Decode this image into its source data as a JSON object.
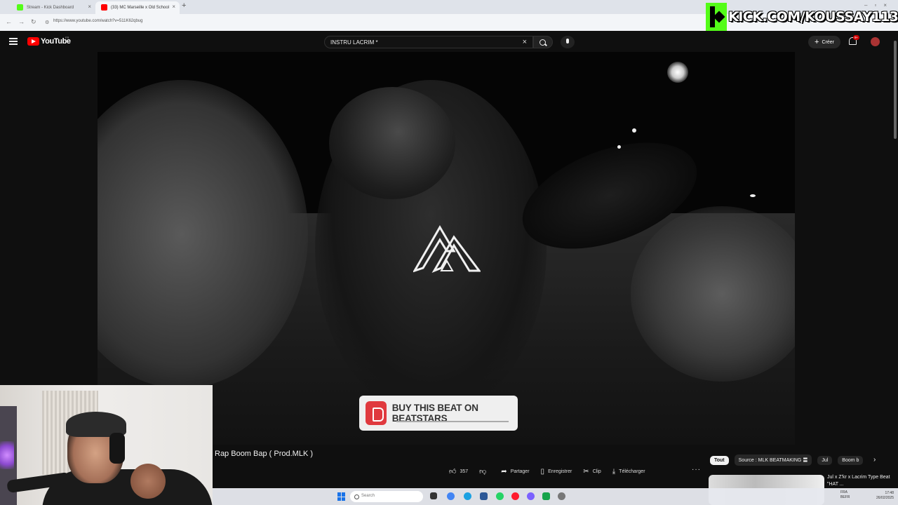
{
  "browser": {
    "tabs": [
      {
        "title": "Stream - Kick Dashboard",
        "favicon_color": "#53fc18"
      },
      {
        "title": "(33) MC Marseille x Old School",
        "favicon_color": "#ff0000"
      }
    ],
    "url": "https://www.youtube.com/watch?v=511K62qbug"
  },
  "overlay": {
    "kick_handle": "KICK.COM/KOUSSAY113"
  },
  "youtube": {
    "brand": "YouTube",
    "region": "FR",
    "search_query": "INSTRU LACRIM *",
    "create_label": "Créer",
    "notification_count": "9+"
  },
  "video": {
    "title": "Rap Boom Bap ( Prod.MLK )",
    "banner_text": "BUY THIS BEAT ON BEATSTARS",
    "actions": {
      "likes": "357",
      "share": "Partager",
      "save": "Enregistrer",
      "clip": "Clip",
      "download": "Télécharger"
    }
  },
  "sidebar": {
    "chips": [
      "Tout",
      "Source : MLK BEATMAKING 〓",
      "Jul",
      "Boom b"
    ],
    "recommendation_title": "Jul x Z'kr x Lacrim Type Beat \"HAT ..."
  },
  "taskbar": {
    "search_placeholder": "Search",
    "lang": "FRA",
    "lang_sub": "BEFR",
    "time": "17:48",
    "date": "26/02/2025"
  },
  "colors": {
    "kick_green": "#53fc18",
    "youtube_red": "#ff0000",
    "beatstars_red": "#e0393e"
  }
}
